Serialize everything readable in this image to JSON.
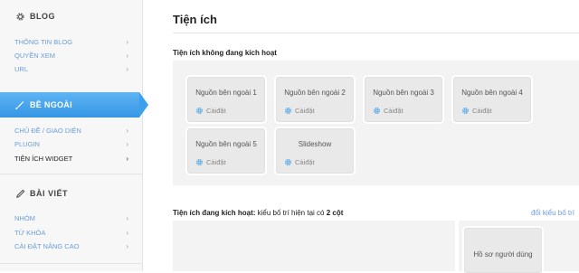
{
  "sidebar": {
    "blog": {
      "title": "BLOG",
      "items": [
        {
          "label": "THÔNG TIN BLOG"
        },
        {
          "label": "QUYỀN XEM"
        },
        {
          "label": "URL"
        }
      ]
    },
    "appearance": {
      "title": "BỀ NGOÀI",
      "items": [
        {
          "label": "CHỦ ĐỀ / GIAO DIỆN"
        },
        {
          "label": "PLUGIN"
        },
        {
          "label": "TIỆN ÍCH WIDGET"
        }
      ]
    },
    "posts": {
      "title": "BÀI VIẾT",
      "items": [
        {
          "label": "NHÓM"
        },
        {
          "label": "TỪ KHÓA"
        },
        {
          "label": "CÀI ĐẶT NÂNG CAO"
        }
      ]
    },
    "chevron": "›"
  },
  "main": {
    "title": "Tiện ích",
    "inactive_title": "Tiện ích không đang kích hoạt",
    "inactive_widgets": [
      {
        "title": "Nguồn bên ngoài 1",
        "settings": "Càiđặt"
      },
      {
        "title": "Nguồn bên ngoài 2",
        "settings": "Càiđặt"
      },
      {
        "title": "Nguồn bên ngoài 3",
        "settings": "Càiđặt"
      },
      {
        "title": "Nguồn bên ngoài 4",
        "settings": "Càiđặt"
      },
      {
        "title": "Nguồn bên ngoài 5",
        "settings": "Càiđặt"
      },
      {
        "title": "Slideshow",
        "settings": "Càiđặt"
      }
    ],
    "active_title": "Tiện ích đang kích hoạt:",
    "active_layout_text": "kiểu bố trí hiện tại có",
    "active_layout_value": "2 cột",
    "change_layout_link": "đổi kiểu bố trí",
    "active_widgets": [
      {
        "title": "Hồ sơ người dùng"
      }
    ]
  },
  "colors": {
    "accent": "#3596e4",
    "link": "#6a9dd8",
    "panel_bg": "#f3f3f3",
    "gear": "#5aacec"
  },
  "icons": {
    "blog": "gear-icon",
    "appearance": "brush-icon",
    "posts": "pencil-icon",
    "widget_settings": "gear-icon"
  }
}
